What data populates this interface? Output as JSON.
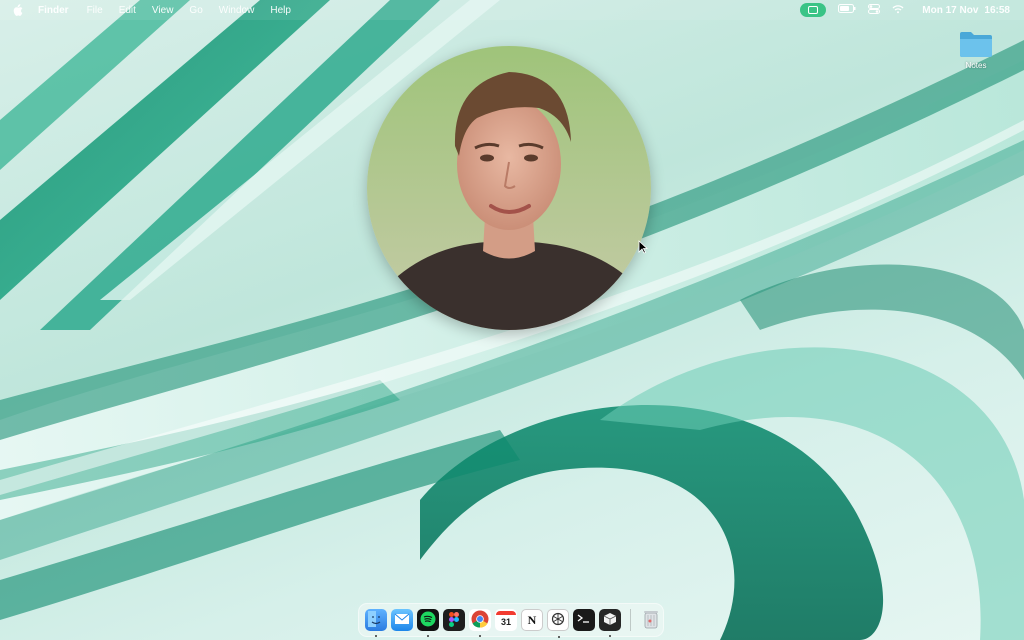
{
  "menubar": {
    "app_name": "Finder",
    "menus": [
      "File",
      "Edit",
      "View",
      "Go",
      "Window",
      "Help"
    ],
    "clock": {
      "date": "Mon 17 Nov",
      "time": "16:58"
    }
  },
  "desktop": {
    "folder_label": "Notes"
  },
  "dock": {
    "apps": [
      {
        "name": "Finder",
        "icon": "finder-icon",
        "running": true
      },
      {
        "name": "Mail",
        "icon": "mail-icon",
        "running": false
      },
      {
        "name": "Spotify",
        "icon": "spotify-icon",
        "running": true
      },
      {
        "name": "Figma",
        "icon": "figma-icon",
        "running": false
      },
      {
        "name": "Chrome",
        "icon": "chrome-icon",
        "running": true
      },
      {
        "name": "Calendar",
        "icon": "calendar-icon",
        "running": false,
        "badge_text": "31"
      },
      {
        "name": "Notion",
        "icon": "notion-icon",
        "running": false,
        "badge_text": "N"
      },
      {
        "name": "ChatGPT",
        "icon": "chatgpt-icon",
        "running": true
      },
      {
        "name": "Terminal",
        "icon": "terminal-icon",
        "running": false
      },
      {
        "name": "App",
        "icon": "cube-app-icon",
        "running": true
      }
    ],
    "trash": {
      "name": "Trash",
      "icon": "trash-icon"
    }
  },
  "colors": {
    "accent_green": "#3ac486",
    "wallpaper_dark": "#0d8a6e",
    "wallpaper_light": "#d8efe9"
  }
}
